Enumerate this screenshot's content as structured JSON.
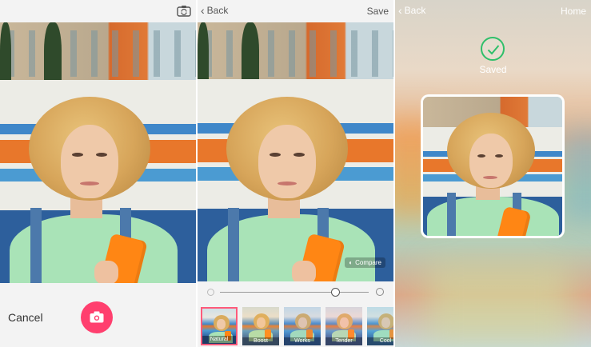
{
  "screen1": {
    "camera_switch_icon": "camera-switch-icon",
    "cancel_label": "Cancel",
    "shutter_icon": "camera-icon",
    "shutter_color": "#ff3f6e"
  },
  "screen2": {
    "back_label": "Back",
    "save_label": "Save",
    "compare_label": "Compare",
    "slider_value": 0.78,
    "filters": [
      {
        "label": "Natural",
        "selected": true
      },
      {
        "label": "Boost",
        "selected": false
      },
      {
        "label": "Works",
        "selected": false
      },
      {
        "label": "Tender",
        "selected": false
      },
      {
        "label": "Cool",
        "selected": false
      }
    ]
  },
  "screen3": {
    "back_label": "Back",
    "home_label": "Home",
    "saved_label": "Saved",
    "check_color": "#2fbf6a"
  }
}
